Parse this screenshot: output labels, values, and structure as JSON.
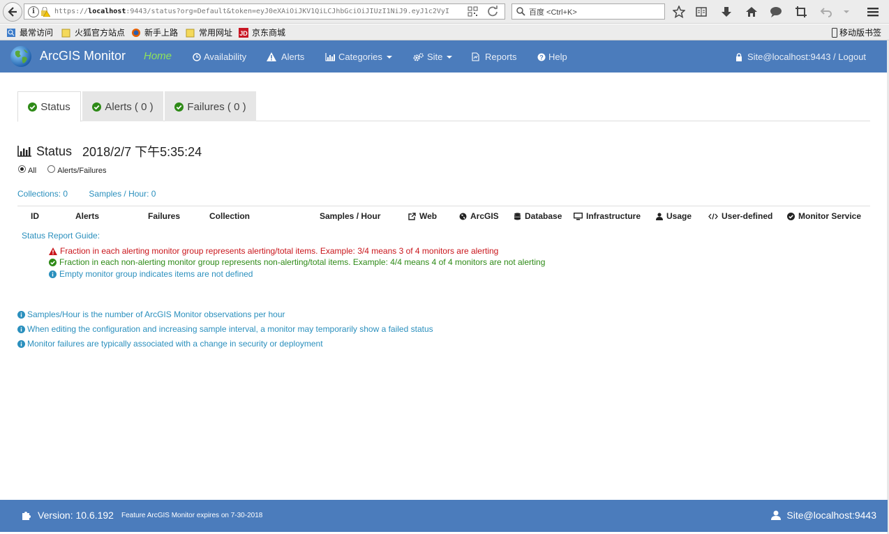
{
  "browser": {
    "url_prefix": "https://",
    "url_host": "localhost",
    "url_rest": ":9443/status?org=Default&token=eyJ0eXAiOiJKV1QiLCJhbGciOiJIUzI1NiJ9.eyJ1c2VyI",
    "search_placeholder": "百度 <Ctrl+K>",
    "bookmarks": [
      "最常访问",
      "火狐官方站点",
      "新手上路",
      "常用网址",
      "京东商城"
    ],
    "mobile_bookmarks": "移动版书签"
  },
  "nav": {
    "brand": "ArcGIS Monitor",
    "home": "Home",
    "availability": "Availability",
    "alerts": "Alerts",
    "categories": "Categories",
    "site": "Site",
    "reports": "Reports",
    "help": "Help",
    "user": "Site@localhost:9443 / Logout"
  },
  "tabs": {
    "status": "Status",
    "alerts": "Alerts ( 0 )",
    "failures": "Failures ( 0 )"
  },
  "status": {
    "title": "Status",
    "timestamp": "2018/2/7 下午5:35:24",
    "filter_all": "All",
    "filter_alerts": "Alerts/Failures",
    "collections": "Collections: 0",
    "samples": "Samples / Hour: 0"
  },
  "table": {
    "headers": [
      "ID",
      "Alerts",
      "Failures",
      "Collection",
      "Samples / Hour",
      "Web",
      "ArcGIS",
      "Database",
      "Infrastructure",
      "Usage",
      "User-defined",
      "Monitor Service"
    ]
  },
  "guide": {
    "title": "Status Report Guide:",
    "alerting": "Fraction in each alerting monitor group represents alerting/total items. Example: 3/4 means 3 of 4 monitors are alerting",
    "non_alerting": "Fraction in each non-alerting monitor group represents non-alerting/total items. Example: 4/4 means 4 of 4 monitors are not alerting",
    "empty": "Empty monitor group indicates items are not defined"
  },
  "notes": [
    "Samples/Hour is the number of ArcGIS Monitor observations per hour",
    "When editing the configuration and increasing sample interval, a monitor may temporarily show a failed status",
    "Monitor failures are typically associated with a change in security or deployment"
  ],
  "footer": {
    "version": "Version: 10.6.192",
    "license": "Feature ArcGIS Monitor expires on 7-30-2018",
    "user": "Site@localhost:9443"
  },
  "colors": {
    "navbar": "#4b7cbc",
    "home_active": "#8fe35a",
    "ok_green": "#2e8a17",
    "alert_red": "#c9151b",
    "info_blue": "#2a8fbd"
  }
}
